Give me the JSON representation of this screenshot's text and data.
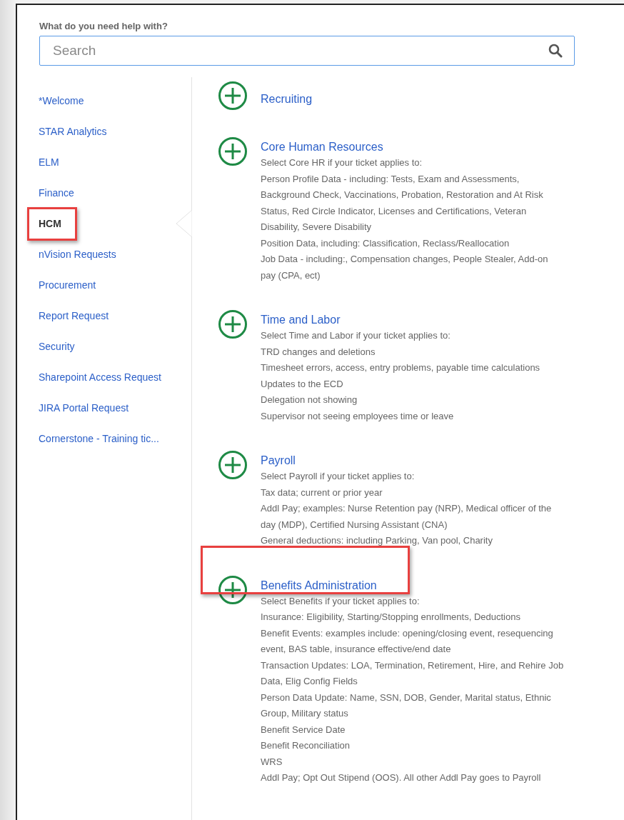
{
  "search": {
    "label": "What do you need help with?",
    "placeholder": "Search"
  },
  "sidebar": {
    "items": [
      {
        "label": "*Welcome",
        "selected": false,
        "highlighted": false
      },
      {
        "label": "STAR Analytics",
        "selected": false,
        "highlighted": false
      },
      {
        "label": "ELM",
        "selected": false,
        "highlighted": false
      },
      {
        "label": "Finance",
        "selected": false,
        "highlighted": false
      },
      {
        "label": "HCM",
        "selected": true,
        "highlighted": true
      },
      {
        "label": "nVision Requests",
        "selected": false,
        "highlighted": false
      },
      {
        "label": "Procurement",
        "selected": false,
        "highlighted": false
      },
      {
        "label": "Report Request",
        "selected": false,
        "highlighted": false
      },
      {
        "label": "Security",
        "selected": false,
        "highlighted": false
      },
      {
        "label": "Sharepoint Access Request",
        "selected": false,
        "highlighted": false
      },
      {
        "label": "JIRA Portal Request",
        "selected": false,
        "highlighted": false
      },
      {
        "label": "Cornerstone - Training tic...",
        "selected": false,
        "highlighted": false
      }
    ]
  },
  "categories": [
    {
      "title": "Recruiting",
      "highlighted": false
    },
    {
      "title": "Core Human Resources",
      "highlighted": false,
      "lines": [
        "Select Core HR if your ticket applies to:",
        "Person Profile Data - including: Tests, Exam and Assessments, Background Check, Vaccinations, Probation, Restoration and At Risk Status, Red Circle Indicator, Licenses and Certifications, Veteran Disability, Severe Disability",
        "Position Data, including: Classification, Reclass/Reallocation",
        "Job Data - including:, Compensation changes, People Stealer, Add-on pay (CPA, ect)"
      ]
    },
    {
      "title": "Time and Labor",
      "highlighted": false,
      "lines": [
        "Select Time and Labor if your ticket applies to:",
        "TRD changes and deletions",
        "Timesheet errors, access, entry problems, payable time calculations",
        "Updates to the ECD",
        "Delegation not showing",
        "Supervisor not seeing employees time or leave"
      ]
    },
    {
      "title": "Payroll",
      "highlighted": false,
      "lines": [
        "Select Payroll if your ticket applies to:",
        "Tax data; current or prior year",
        "Addl Pay; examples: Nurse Retention pay (NRP), Medical officer of the day (MDP), Certified Nursing Assistant (CNA)",
        "General deductions: including Parking, Van pool, Charity"
      ]
    },
    {
      "title": "Benefits Administration",
      "highlighted": true,
      "lines": [
        "Select Benefits if your ticket applies to:",
        "Insurance: Eligibility, Starting/Stopping enrollments, Deductions",
        "Benefit Events: examples include: opening/closing event, resequencing event, BAS table, insurance effective/end date",
        "Transaction Updates: LOA, Termination, Retirement, Hire, and Rehire Job Data, Elig Config Fields",
        "Person Data Update: Name, SSN, DOB, Gender, Marital status, Ethnic Group, Military status",
        "Benefit Service Date",
        "Benefit Reconciliation",
        "WRS",
        "Addl Pay; Opt Out Stipend (OOS). All other Addl Pay goes to Payroll"
      ]
    }
  ]
}
